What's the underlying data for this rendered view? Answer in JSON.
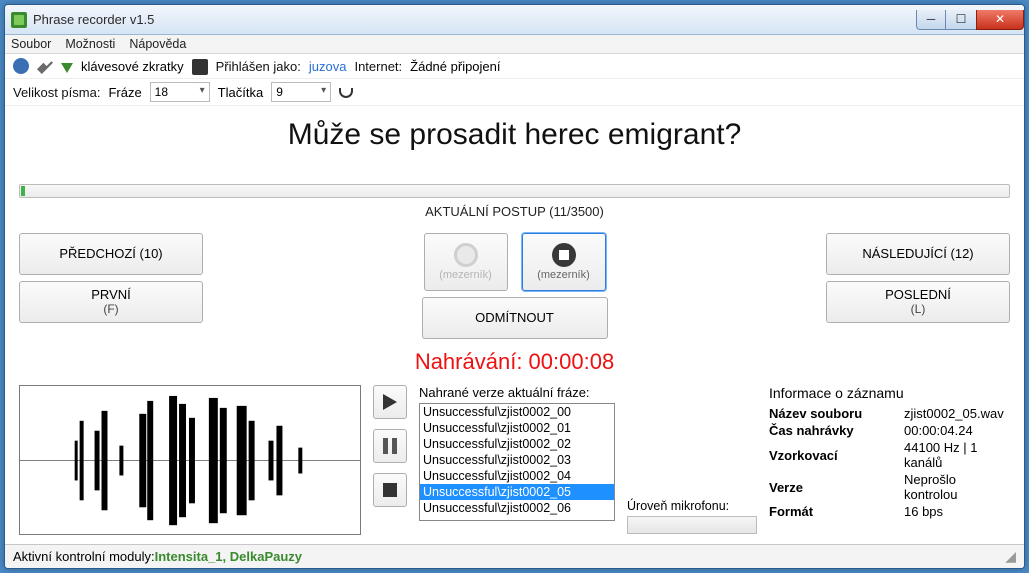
{
  "window": {
    "title": "Phrase recorder v1.5"
  },
  "menu": {
    "file": "Soubor",
    "options": "Možnosti",
    "help": "Nápověda"
  },
  "toolstrip1": {
    "shortcuts": "klávesové zkratky",
    "loggedAsLabel": "Přihlášen jako:",
    "user": "juzova",
    "internetLabel": "Internet:",
    "internetValue": "Žádné připojení"
  },
  "toolstrip2": {
    "fontSizeLabel": "Velikost písma:",
    "phraseLabel": "Fráze",
    "phraseValue": "18",
    "buttonsLabel": "Tlačítka",
    "buttonsValue": "9"
  },
  "prompt": "Může se prosadit herec emigrant?",
  "progress": {
    "label": "AKTUÁLNÍ POSTUP (11/3500)"
  },
  "nav": {
    "prev": "PŘEDCHOZÍ (10)",
    "first": "PRVNÍ",
    "firstKey": "(F)",
    "next": "NÁSLEDUJÍCÍ (12)",
    "last": "POSLEDNÍ",
    "lastKey": "(L)"
  },
  "rec": {
    "recordHint": "(mezerník)",
    "stopHint": "(mezerník)",
    "reject": "ODMÍTNOUT",
    "status": "Nahrávání: 00:00:08"
  },
  "versions": {
    "label": "Nahrané verze aktuální fráze:",
    "items": [
      "Unsuccessful\\zjist0002_00",
      "Unsuccessful\\zjist0002_01",
      "Unsuccessful\\zjist0002_02",
      "Unsuccessful\\zjist0002_03",
      "Unsuccessful\\zjist0002_04",
      "Unsuccessful\\zjist0002_05",
      "Unsuccessful\\zjist0002_06"
    ],
    "selectedIndex": 5
  },
  "mic": {
    "label": "Úroveň mikrofonu:"
  },
  "info": {
    "title": "Informace o záznamu",
    "filenameK": "Název souboru",
    "filenameV": "zjist0002_05.wav",
    "durationK": "Čas nahrávky",
    "durationV": "00:00:04.24",
    "sampleK": "Vzorkovací",
    "sampleV": "44100 Hz | 1 kanálů",
    "versionK": "Verze",
    "versionV": "Neprošlo kontrolou",
    "formatK": "Formát",
    "formatV": "16 bps"
  },
  "status": {
    "label": "Aktivní kontrolní moduly:  ",
    "modules": "Intensita_1, DelkaPauzy"
  }
}
